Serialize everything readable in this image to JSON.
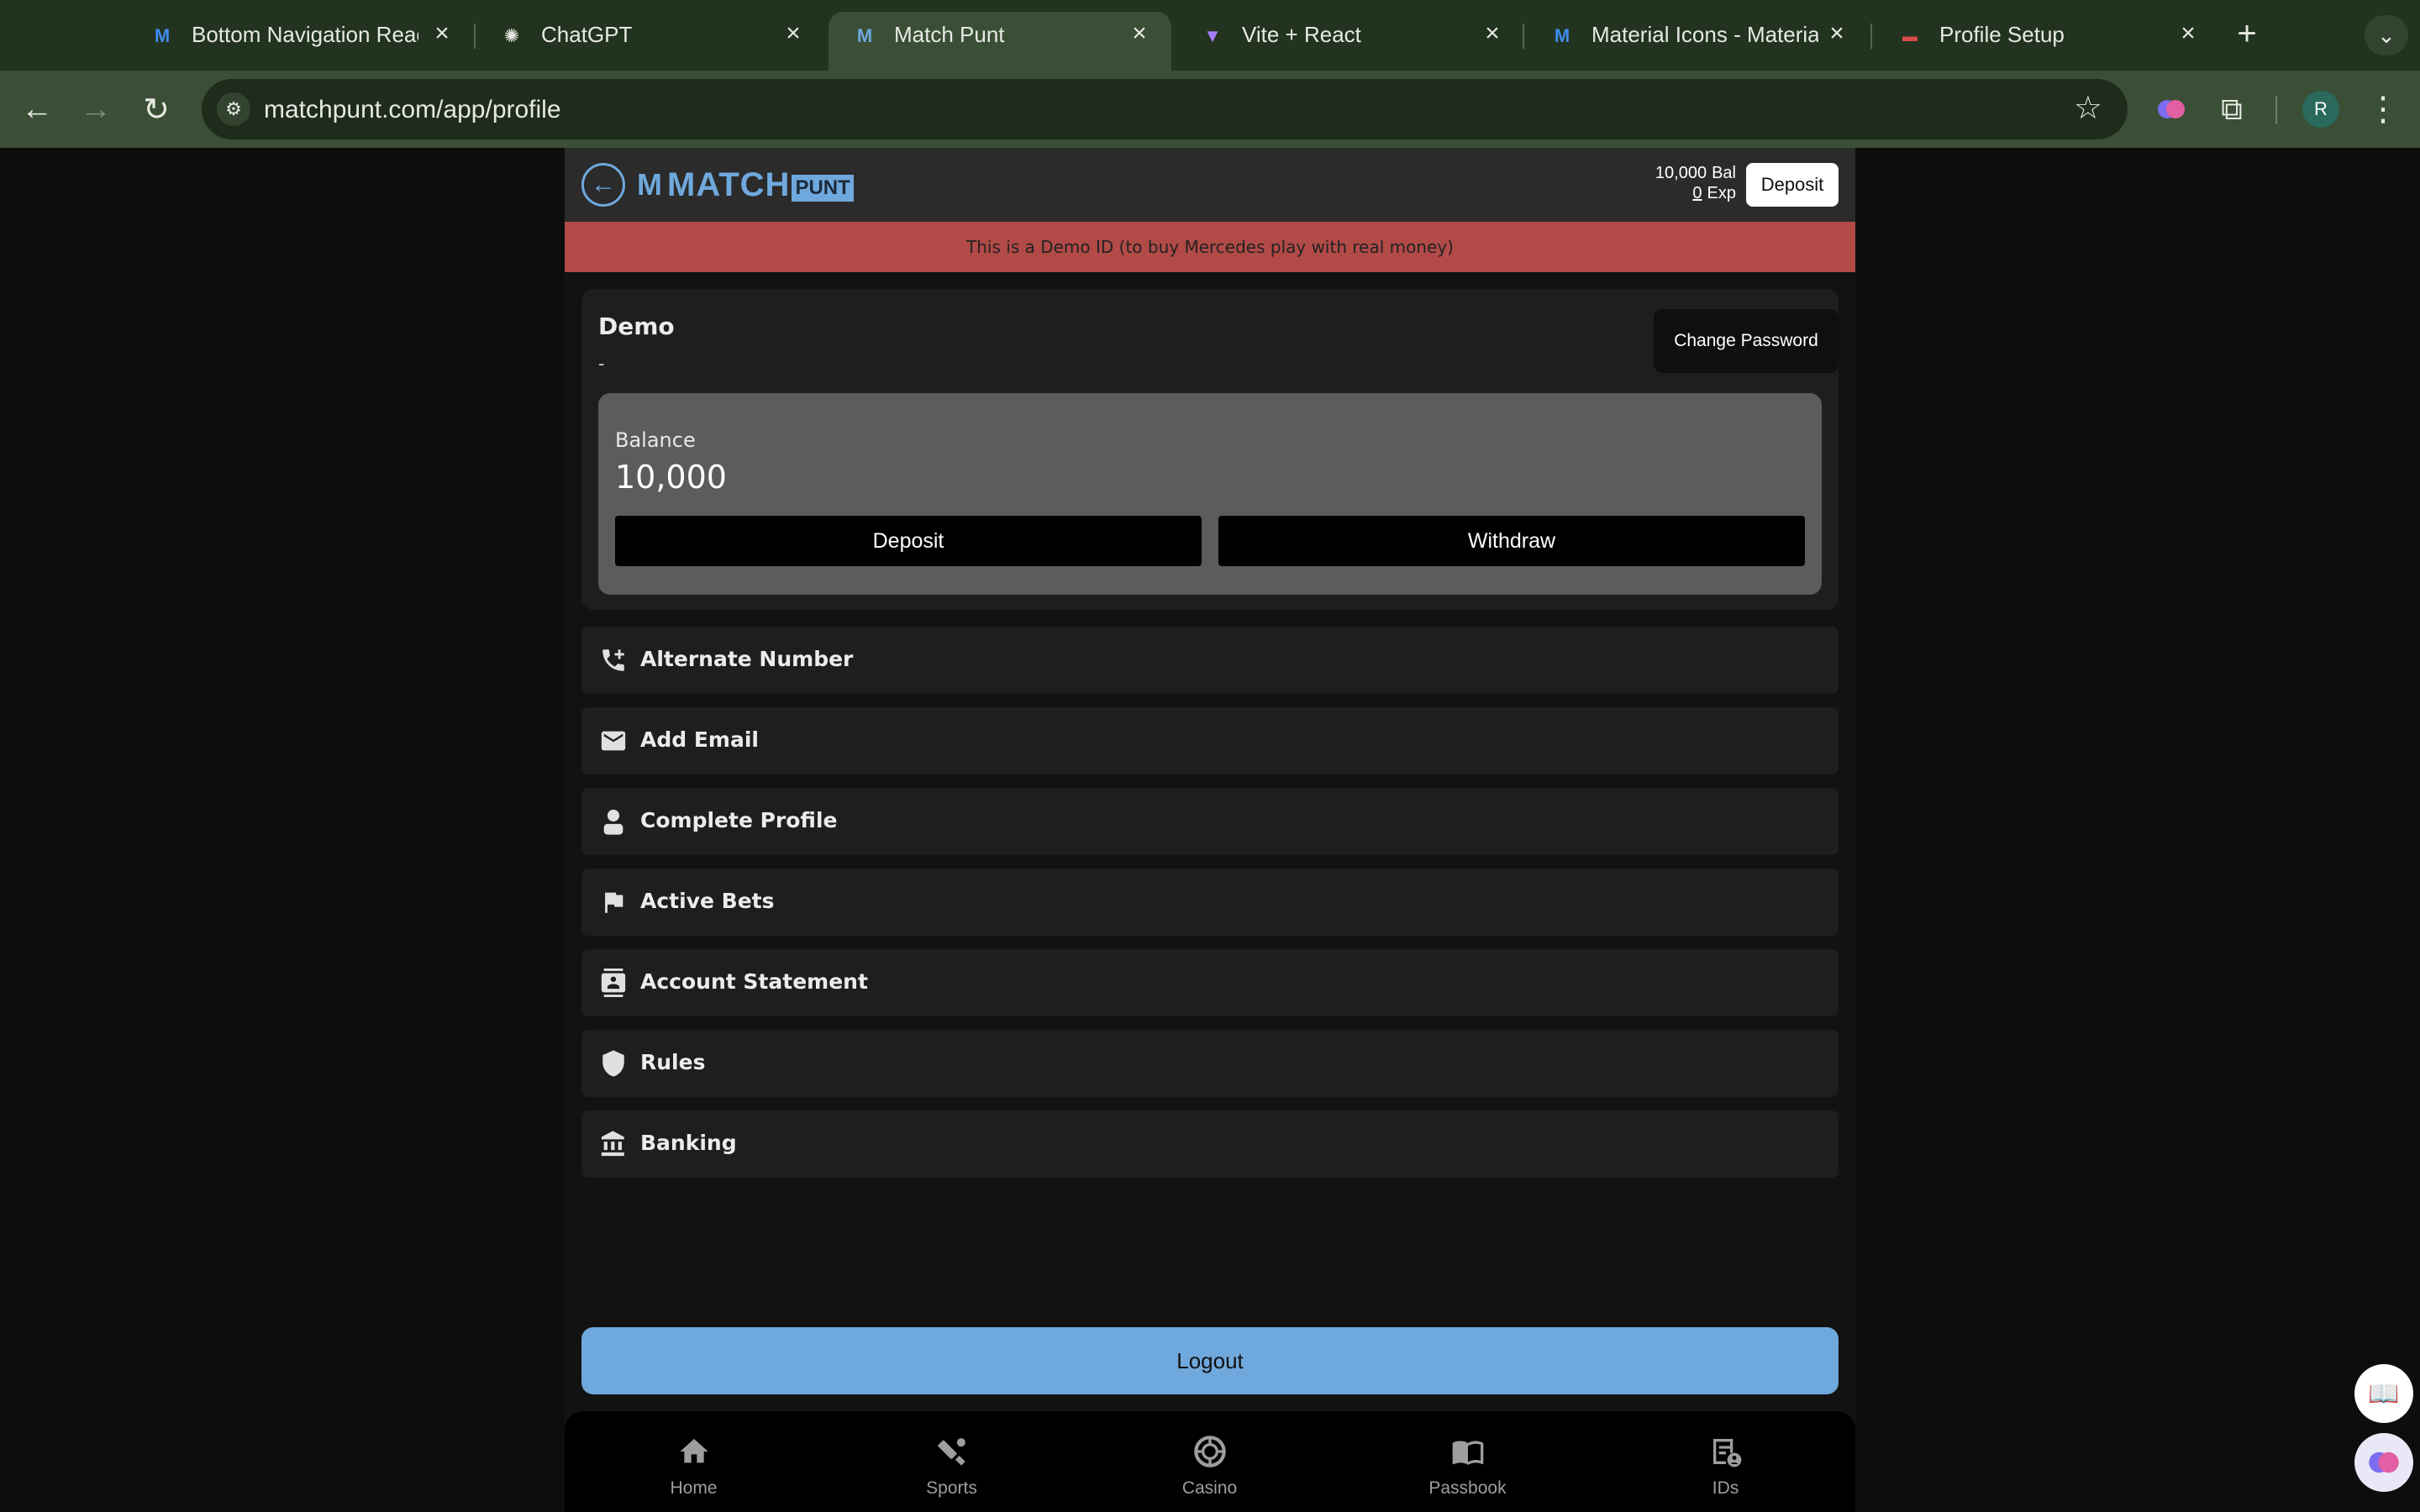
{
  "browser": {
    "tabs": [
      {
        "title": "Bottom Navigation Reac",
        "icon": "mui-logo-icon"
      },
      {
        "title": "ChatGPT",
        "icon": "openai-icon"
      },
      {
        "title": "Match Punt",
        "icon": "matchpunt-icon",
        "active": true
      },
      {
        "title": "Vite + React",
        "icon": "vite-icon"
      },
      {
        "title": "Material Icons - Material",
        "icon": "mui-logo-icon"
      },
      {
        "title": "Profile Setup",
        "icon": "profile-setup-icon"
      }
    ],
    "url": "matchpunt.com/app/profile",
    "profile_initial": "R"
  },
  "header": {
    "logo_main": "MATCH",
    "logo_sub": "PUNT",
    "balance_value": "10,000",
    "balance_label": "Bal",
    "exposure_value": "0",
    "exposure_label": "Exp",
    "deposit_label": "Deposit"
  },
  "banner": {
    "text": "This is a Demo ID (to buy Mercedes play with real money)"
  },
  "profile": {
    "name": "Demo",
    "subtitle": "-",
    "change_password_label": "Change Password",
    "balance_label": "Balance",
    "balance_value": "10,000",
    "deposit_label": "Deposit",
    "withdraw_label": "Withdraw"
  },
  "menu": [
    {
      "label": "Alternate Number",
      "icon": "add-call-icon"
    },
    {
      "label": "Add Email",
      "icon": "email-icon"
    },
    {
      "label": "Complete Profile",
      "icon": "person-icon"
    },
    {
      "label": "Active Bets",
      "icon": "flag-icon"
    },
    {
      "label": "Account Statement",
      "icon": "contacts-icon"
    },
    {
      "label": "Rules",
      "icon": "shield-icon"
    },
    {
      "label": "Banking",
      "icon": "bank-icon"
    }
  ],
  "logout_label": "Logout",
  "bottom_nav": [
    {
      "label": "Home",
      "icon": "home-icon"
    },
    {
      "label": "Sports",
      "icon": "sports-cricket-icon"
    },
    {
      "label": "Casino",
      "icon": "casino-chip-icon"
    },
    {
      "label": "Passbook",
      "icon": "book-icon"
    },
    {
      "label": "IDs",
      "icon": "ids-icon"
    }
  ],
  "colors": {
    "accent": "#6fa8dc",
    "banner": "#b24a47",
    "chrome": "#3a4f36"
  }
}
